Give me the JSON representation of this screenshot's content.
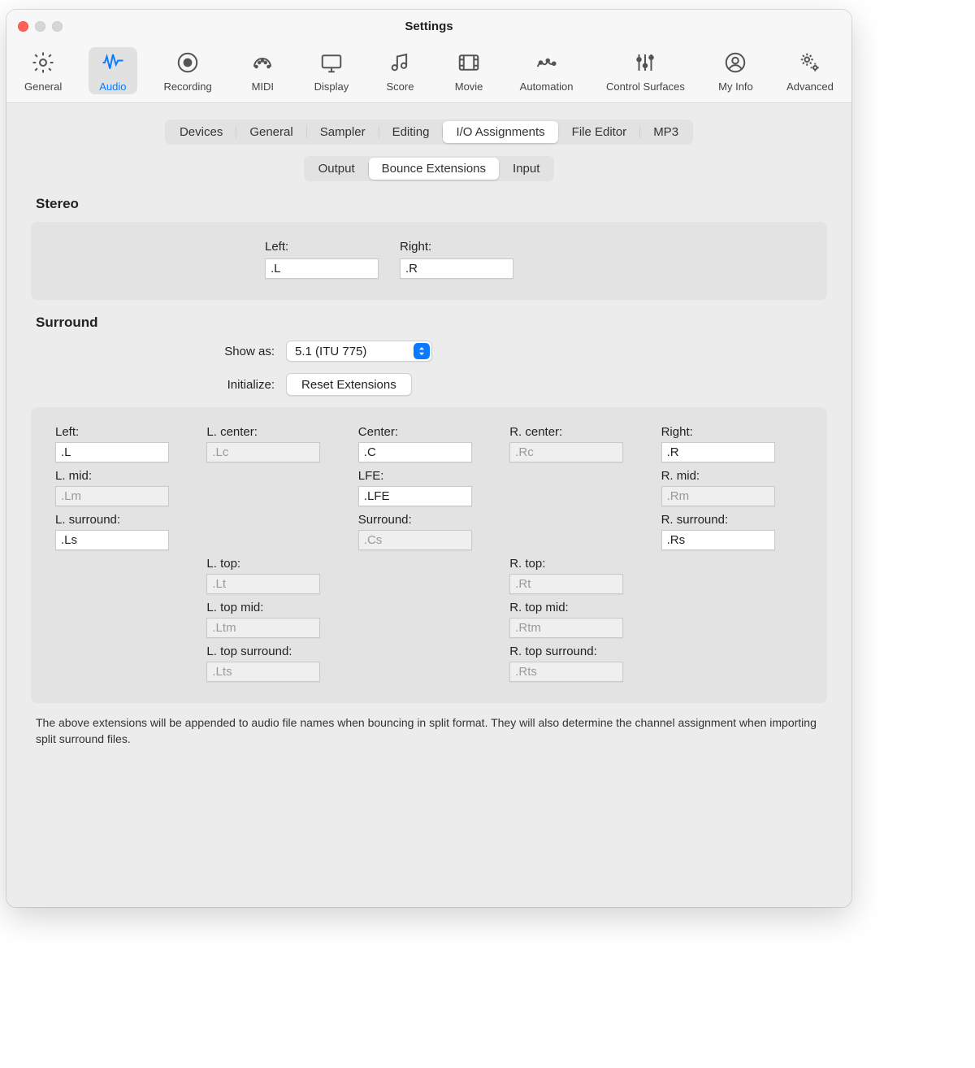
{
  "window": {
    "title": "Settings"
  },
  "toolbar": [
    {
      "id": "general",
      "label": "General"
    },
    {
      "id": "audio",
      "label": "Audio",
      "active": true
    },
    {
      "id": "recording",
      "label": "Recording"
    },
    {
      "id": "midi",
      "label": "MIDI"
    },
    {
      "id": "display",
      "label": "Display"
    },
    {
      "id": "score",
      "label": "Score"
    },
    {
      "id": "movie",
      "label": "Movie"
    },
    {
      "id": "automation",
      "label": "Automation"
    },
    {
      "id": "control-surfaces",
      "label": "Control Surfaces"
    },
    {
      "id": "my-info",
      "label": "My Info"
    },
    {
      "id": "advanced",
      "label": "Advanced"
    }
  ],
  "tabs1": {
    "items": [
      "Devices",
      "General",
      "Sampler",
      "Editing",
      "I/O Assignments",
      "File Editor",
      "MP3"
    ],
    "active": "I/O Assignments"
  },
  "tabs2": {
    "items": [
      "Output",
      "Bounce Extensions",
      "Input"
    ],
    "active": "Bounce Extensions"
  },
  "stereo": {
    "heading": "Stereo",
    "left_label": "Left:",
    "left_value": ".L",
    "right_label": "Right:",
    "right_value": ".R"
  },
  "surround": {
    "heading": "Surround",
    "show_as_label": "Show as:",
    "show_as_value": "5.1 (ITU 775)",
    "initialize_label": "Initialize:",
    "reset_button": "Reset Extensions",
    "grid": [
      [
        {
          "label": "Left:",
          "value": ".L",
          "enabled": true
        },
        {
          "label": "L. center:",
          "value": ".Lc",
          "enabled": false
        },
        {
          "label": "Center:",
          "value": ".C",
          "enabled": true
        },
        {
          "label": "R. center:",
          "value": ".Rc",
          "enabled": false
        },
        {
          "label": "Right:",
          "value": ".R",
          "enabled": true
        }
      ],
      [
        {
          "label": "L. mid:",
          "value": ".Lm",
          "enabled": false
        },
        null,
        {
          "label": "LFE:",
          "value": ".LFE",
          "enabled": true
        },
        null,
        {
          "label": "R. mid:",
          "value": ".Rm",
          "enabled": false
        }
      ],
      [
        {
          "label": "L. surround:",
          "value": ".Ls",
          "enabled": true
        },
        null,
        {
          "label": "Surround:",
          "value": ".Cs",
          "enabled": false
        },
        null,
        {
          "label": "R. surround:",
          "value": ".Rs",
          "enabled": true
        }
      ],
      [
        null,
        {
          "label": "L. top:",
          "value": ".Lt",
          "enabled": false
        },
        null,
        {
          "label": "R. top:",
          "value": ".Rt",
          "enabled": false
        },
        null
      ],
      [
        null,
        {
          "label": "L. top mid:",
          "value": ".Ltm",
          "enabled": false
        },
        null,
        {
          "label": "R. top mid:",
          "value": ".Rtm",
          "enabled": false
        },
        null
      ],
      [
        null,
        {
          "label": "L. top surround:",
          "value": ".Lts",
          "enabled": false
        },
        null,
        {
          "label": "R. top surround:",
          "value": ".Rts",
          "enabled": false
        },
        null
      ]
    ]
  },
  "footer": "The above extensions will be appended to audio file names when bouncing in split format. They will also determine the channel assignment when importing split surround files."
}
